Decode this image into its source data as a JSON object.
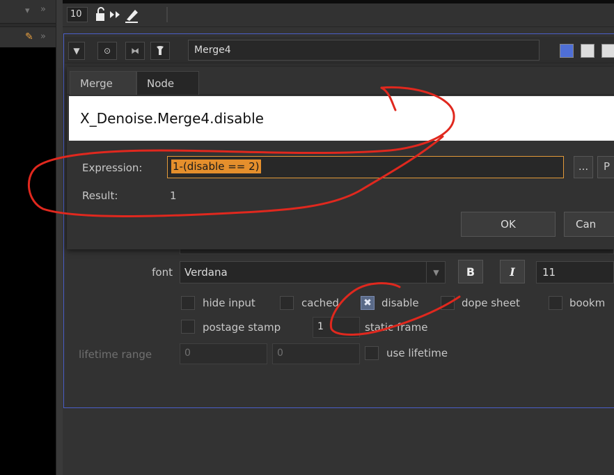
{
  "toolbar": {
    "frame_number": "10"
  },
  "node_panel": {
    "name": "Merge4",
    "tabs": [
      {
        "label": "Merge"
      },
      {
        "label": "Node"
      }
    ]
  },
  "expression_dialog": {
    "knob_path": "X_Denoise.Merge4.disable",
    "expression_label": "Expression:",
    "expression_value": "1-(disable == 2)",
    "result_label": "Result:",
    "result_value": "1",
    "ellipsis_label": "...",
    "p_label": "P",
    "ok_label": "OK",
    "cancel_label": "Can"
  },
  "node_tab": {
    "font_label": "font",
    "font_value": "Verdana",
    "bold_label": "B",
    "italic_label": "I",
    "font_size": "11",
    "checkboxes_row1": [
      {
        "label": "hide input",
        "checked": false
      },
      {
        "label": "cached",
        "checked": false
      },
      {
        "label": "disable",
        "checked": true
      },
      {
        "label": "dope sheet",
        "checked": false
      },
      {
        "label": "bookm",
        "checked": false
      }
    ],
    "postage_stamp_label": "postage stamp",
    "static_frame_value": "1",
    "static_frame_label": "static frame",
    "lifetime_range_label": "lifetime range",
    "lifetime_start": "0",
    "lifetime_end": "0",
    "use_lifetime_label": "use lifetime"
  },
  "annotation": {
    "color": "#e0281e"
  }
}
